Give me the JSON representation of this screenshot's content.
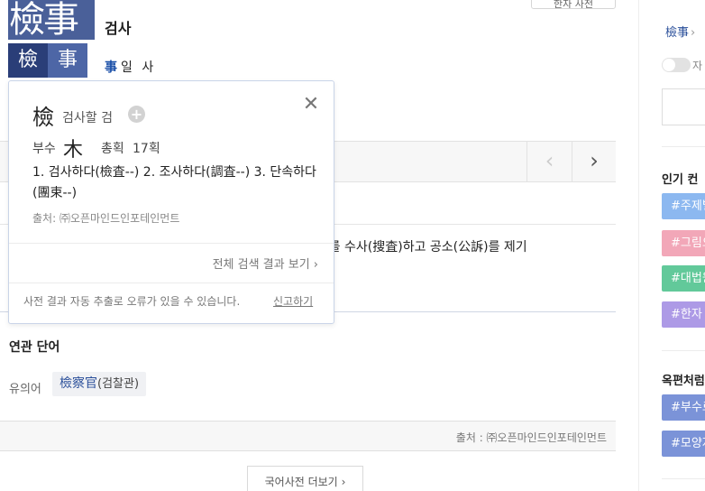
{
  "top_button": {
    "label": "한자 사전"
  },
  "entry": {
    "hanja": "檢事",
    "reading": "검사",
    "chars": [
      {
        "char": "檢",
        "selected": true
      },
      {
        "char": "事",
        "selected": false
      }
    ],
    "detail_hanja": "事",
    "detail_reading": "일 사"
  },
  "meaning_text": "범죄(犯罪)를 수사(搜査)하고 공소(公訴)를 제기",
  "related": {
    "title": "연관 단어",
    "synonym_label": "유의어",
    "synonym_hanja": "檢察官",
    "synonym_reading": "(검찰관)"
  },
  "source_bar": "출처 : ㈜오픈마인드인포테인먼트",
  "more_button": "국어사전 더보기",
  "popup": {
    "hanja": "檢",
    "reading": "검사할 검",
    "radical_label": "부수",
    "radical": "木",
    "strokes_label": "총획",
    "strokes": "17획",
    "meanings": "1. 검사하다(檢査--) 2. 조사하다(調査--) 3. 단속하다(團束--)",
    "source": "출처: ㈜오픈마인드인포테인먼트",
    "all_results": "전체 검색 결과 보기",
    "disclaimer": "사전 결과 자동 추출로 오류가 있을 수 있습니다.",
    "report": "신고하기"
  },
  "sidebar": {
    "crumb": "檢事",
    "toggle_label": "자",
    "popular_title": "인기 컨",
    "popular_tags": [
      {
        "label": "#주제별",
        "color": "#8cb8f0"
      },
      {
        "label": "#그림으",
        "color": "#f2a7b8"
      },
      {
        "label": "#대법원",
        "color": "#62c99a"
      },
      {
        "label": "#한자",
        "color": "#ad9ae6"
      }
    ],
    "okpyeon_title": "옥편처럼",
    "okpyeon_tags": [
      {
        "label": "#부수로",
        "color": "#7b93d8"
      },
      {
        "label": "#모양자",
        "color": "#7b93d8"
      }
    ]
  }
}
